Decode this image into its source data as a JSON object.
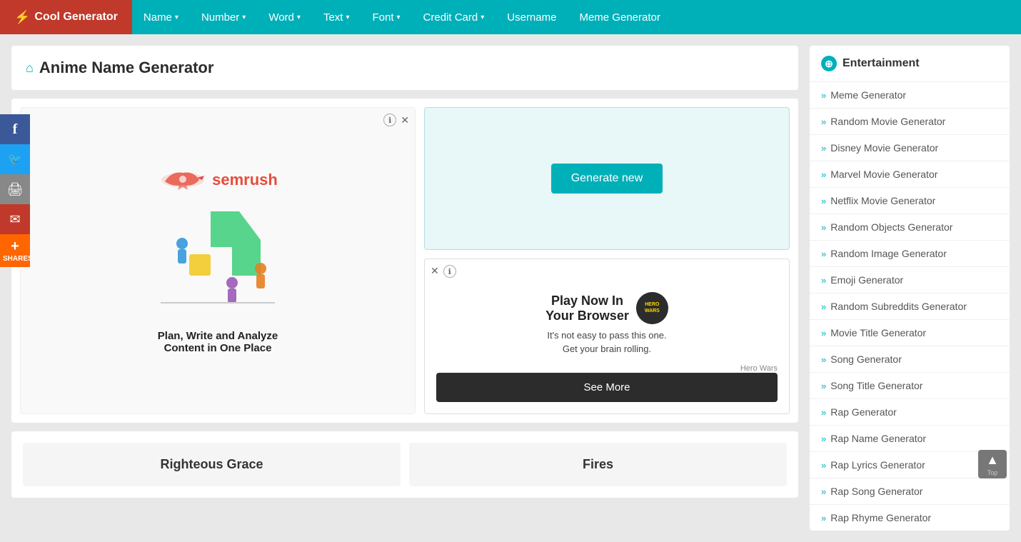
{
  "brand": {
    "name": "Cool Generator",
    "bolt": "⚡"
  },
  "nav": {
    "items": [
      {
        "label": "Name",
        "has_dropdown": true
      },
      {
        "label": "Number",
        "has_dropdown": true
      },
      {
        "label": "Word",
        "has_dropdown": true
      },
      {
        "label": "Text",
        "has_dropdown": true
      },
      {
        "label": "Font",
        "has_dropdown": true
      },
      {
        "label": "Credit Card",
        "has_dropdown": true
      },
      {
        "label": "Username",
        "has_dropdown": false
      },
      {
        "label": "Meme Generator",
        "has_dropdown": false
      }
    ]
  },
  "page": {
    "title": "Anime Name Generator",
    "home_icon": "⌂"
  },
  "ad_left": {
    "semrush_name": "semrush",
    "tagline": "Plan, Write and Analyze\nContent in One Place"
  },
  "generate_button": {
    "label": "Generate new"
  },
  "hero_wars": {
    "title_line1": "Play Now In",
    "title_line2": "Your Browser",
    "subtitle": "It's not easy to pass this one.",
    "subtitle2": "Get your brain rolling.",
    "credit": "Hero Wars",
    "cta": "See More"
  },
  "results": [
    {
      "name": "Righteous Grace"
    },
    {
      "name": "Fires"
    }
  ],
  "sidebar": {
    "header": "Entertainment",
    "items": [
      {
        "label": "Meme Generator"
      },
      {
        "label": "Random Movie Generator"
      },
      {
        "label": "Disney Movie Generator"
      },
      {
        "label": "Marvel Movie Generator"
      },
      {
        "label": "Netflix Movie Generator"
      },
      {
        "label": "Random Objects Generator"
      },
      {
        "label": "Random Image Generator"
      },
      {
        "label": "Emoji Generator"
      },
      {
        "label": "Random Subreddits Generator"
      },
      {
        "label": "Movie Title Generator"
      },
      {
        "label": "Song Generator"
      },
      {
        "label": "Song Title Generator"
      },
      {
        "label": "Rap Generator"
      },
      {
        "label": "Rap Name Generator"
      },
      {
        "label": "Rap Lyrics Generator"
      },
      {
        "label": "Rap Song Generator"
      },
      {
        "label": "Rap Rhyme Generator"
      }
    ]
  },
  "social": {
    "facebook": "f",
    "twitter": "t",
    "print": "🖨",
    "email": "✉",
    "shares_label": "SHARES"
  },
  "scroll_top": {
    "icon": "▲",
    "label": "Top"
  }
}
